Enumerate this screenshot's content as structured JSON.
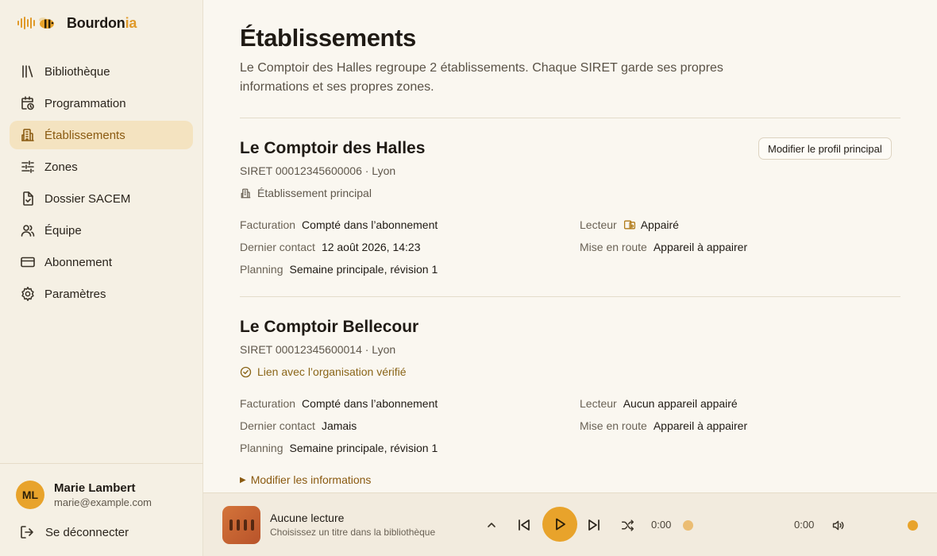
{
  "brand": {
    "name_main": "Bourdon",
    "name_accent": "ia",
    "colors": {
      "accent": "#e09a2a"
    }
  },
  "sidebar": {
    "items": [
      {
        "label": "Bibliothèque",
        "icon": "library-icon"
      },
      {
        "label": "Programmation",
        "icon": "calendar-clock-icon"
      },
      {
        "label": "Établissements",
        "icon": "building-icon",
        "active": true
      },
      {
        "label": "Zones",
        "icon": "sliders-icon"
      },
      {
        "label": "Dossier SACEM",
        "icon": "file-check-icon"
      },
      {
        "label": "Équipe",
        "icon": "users-icon"
      },
      {
        "label": "Abonnement",
        "icon": "credit-card-icon"
      },
      {
        "label": "Paramètres",
        "icon": "gear-icon"
      }
    ]
  },
  "user": {
    "initials": "ML",
    "name": "Marie Lambert",
    "email": "marie@example.com",
    "logout_label": "Se déconnecter"
  },
  "main": {
    "title": "Établissements",
    "description": "Le Comptoir des Halles regroupe 2 établissements. Chaque SIRET garde ses propres informations et ses propres zones.",
    "establishments": [
      {
        "name": "Le Comptoir des Halles",
        "meta": "SIRET 00012345600006 · Lyon",
        "badge": "Établissement principal",
        "action_label": "Modifier le profil principal",
        "fields": {
          "billing_k": "Facturation",
          "billing_v": "Compté dans l’abonnement",
          "contact_k": "Dernier contact",
          "contact_v": "12 août 2026, 14:23",
          "planning_k": "Planning",
          "planning_v": "Semaine principale, révision 1",
          "player_k": "Lecteur",
          "player_v": "Appairé",
          "setup_k": "Mise en route",
          "setup_v": "Appareil à appairer"
        }
      },
      {
        "name": "Le Comptoir Bellecour",
        "meta": "SIRET 00012345600014 · Lyon",
        "badge": "Lien avec l’organisation vérifié",
        "disclosure_label": "Modifier les informations",
        "fields": {
          "billing_k": "Facturation",
          "billing_v": "Compté dans l’abonnement",
          "contact_k": "Dernier contact",
          "contact_v": "Jamais",
          "planning_k": "Planning",
          "planning_v": "Semaine principale, révision 1",
          "player_k": "Lecteur",
          "player_v": "Aucun appareil appairé",
          "setup_k": "Mise en route",
          "setup_v": "Appareil à appairer"
        }
      }
    ]
  },
  "player": {
    "title": "Aucune lecture",
    "subtitle": "Choisissez un titre dans la bibliothèque",
    "elapsed": "0:00",
    "duration": "0:00",
    "progress": 0,
    "volume": 1.0
  }
}
